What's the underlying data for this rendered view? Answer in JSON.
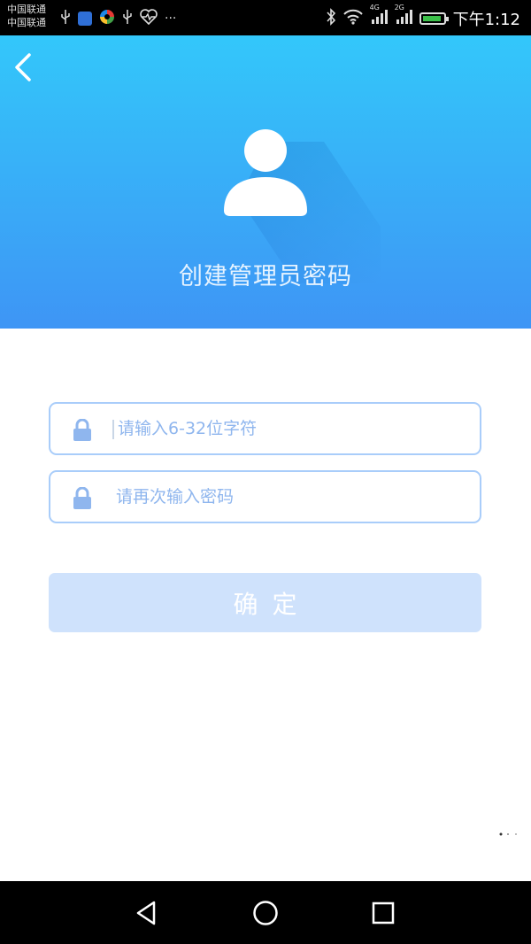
{
  "status_bar": {
    "carrier_1": "中国联通",
    "carrier_2": "中国联通",
    "time": "下午1:12",
    "network_1": "4G",
    "network_2": "2G",
    "icons": [
      "usb-icon",
      "app-icon",
      "app-icon",
      "usb-icon",
      "heart-rate-icon",
      "more-icon",
      "bluetooth-icon",
      "wifi-icon",
      "signal-icon",
      "signal-icon",
      "battery-icon"
    ],
    "more": "···"
  },
  "header": {
    "title": "创建管理员密码",
    "back_icon": "chevron-left-icon",
    "avatar_icon": "user-icon",
    "gradient_top": "#33c7fa",
    "gradient_bottom": "#3e95f5"
  },
  "form": {
    "password": {
      "placeholder": "请输入6-32位字符",
      "value": "",
      "icon": "lock-icon"
    },
    "confirm_password": {
      "placeholder": "请再次输入密码",
      "value": "",
      "icon": "lock-icon"
    },
    "border_color": "#a9cdfa",
    "icon_color": "#8fb6ee"
  },
  "confirm_button": {
    "label": "确定",
    "background": "#cfe2fc",
    "state": "disabled"
  },
  "nav_bar": {
    "items": [
      "back-triangle-icon",
      "home-circle-icon",
      "recents-square-icon"
    ]
  }
}
